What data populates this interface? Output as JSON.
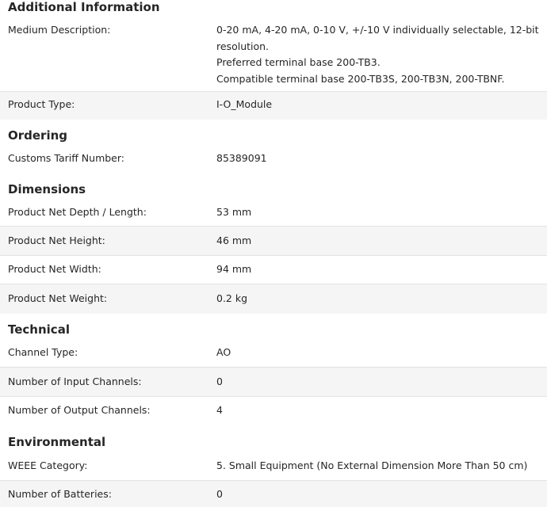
{
  "sections": [
    {
      "title": "Additional Information",
      "rows": [
        {
          "label": "Medium Description:",
          "value_lines": [
            "0-20 mA, 4-20 mA, 0-10 V, +/-10 V individually selectable, 12-bit",
            "resolution.",
            "Preferred terminal base 200-TB3.",
            "Compatible terminal base 200-TB3S, 200-TB3N, 200-TBNF."
          ]
        },
        {
          "label": "Product Type:",
          "value": "I-O_Module"
        }
      ]
    },
    {
      "title": "Ordering",
      "rows": [
        {
          "label": "Customs Tariff Number:",
          "value": "85389091"
        }
      ]
    },
    {
      "title": "Dimensions",
      "rows": [
        {
          "label": "Product Net Depth / Length:",
          "value": "53 mm"
        },
        {
          "label": "Product Net Height:",
          "value": "46 mm"
        },
        {
          "label": "Product Net Width:",
          "value": "94 mm"
        },
        {
          "label": "Product Net Weight:",
          "value": "0.2 kg"
        }
      ]
    },
    {
      "title": "Technical",
      "rows": [
        {
          "label": "Channel Type:",
          "value": "AO"
        },
        {
          "label": "Number of Input Channels:",
          "value": "0"
        },
        {
          "label": "Number of Output Channels:",
          "value": "4"
        }
      ]
    },
    {
      "title": "Environmental",
      "rows": [
        {
          "label": "WEEE Category:",
          "value": "5. Small Equipment (No External Dimension More Than 50 cm)"
        },
        {
          "label": "Number of Batteries:",
          "value": "0"
        }
      ]
    }
  ]
}
